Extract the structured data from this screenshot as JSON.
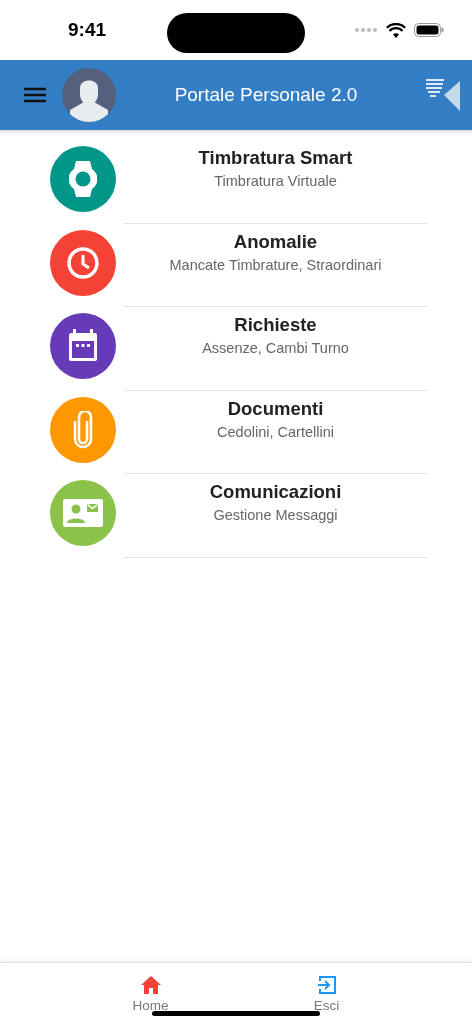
{
  "status_bar": {
    "time": "9:41"
  },
  "header": {
    "title": "Portale Personale 2.0"
  },
  "menu": [
    {
      "kind": "watch",
      "color": "#009688",
      "title": "Timbratura Smart",
      "subtitle": "Timbratura Virtuale"
    },
    {
      "kind": "clock",
      "color": "#f44336",
      "title": "Anomalie",
      "subtitle": "Mancate Timbrature, Straordinari"
    },
    {
      "kind": "calendar",
      "color": "#673ab7",
      "title": "Richieste",
      "subtitle": "Assenze, Cambi Turno"
    },
    {
      "kind": "clip",
      "color": "#ff9800",
      "title": "Documenti",
      "subtitle": "Cedolini, Cartellini"
    },
    {
      "kind": "contact",
      "color": "#8bc34a",
      "title": "Comunicazioni",
      "subtitle": "Gestione Messaggi"
    }
  ],
  "bottom_nav": [
    {
      "kind": "home",
      "label": "Home",
      "color": "#f44336"
    },
    {
      "kind": "exit",
      "label": "Esci",
      "color": "#2196f3"
    }
  ]
}
